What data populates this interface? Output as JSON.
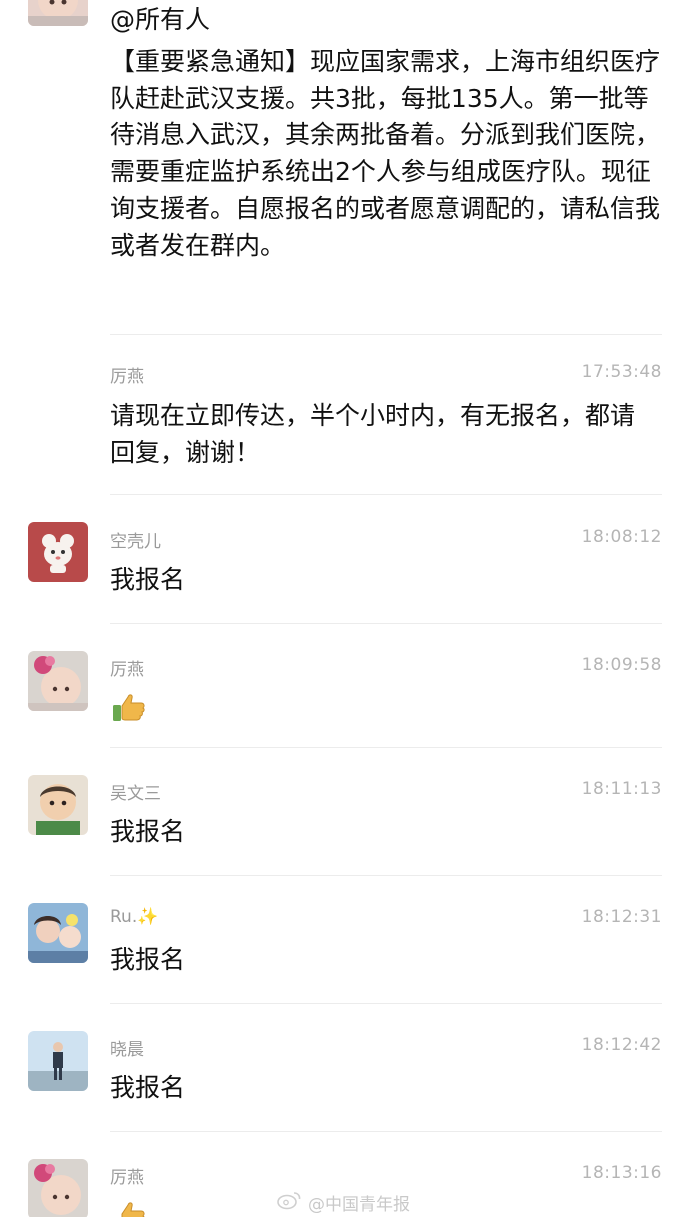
{
  "messages": [
    {
      "mention": "@所有人",
      "body": "【重要紧急通知】现应国家需求，上海市组织医疗队赶赴武汉支援。共3批，每批135人。第一批等待消息入武汉，其余两批备着。分派到我们医院，需要重症监护系统出2个人参与组成医疗队。现征询支援者。自愿报名的或者愿意调配的，请私信我或者发在群内。"
    },
    {
      "sender": "厉燕",
      "time": "17:53:48",
      "body": "请现在立即传达，半个小时内，有无报名，都请回复，谢谢！"
    },
    {
      "sender": "空壳儿",
      "time": "18:08:12",
      "body": "我报名"
    },
    {
      "sender": "厉燕",
      "time": "18:09:58",
      "emoji": "thumbs-up"
    },
    {
      "sender": "吴文三",
      "time": "18:11:13",
      "body": "我报名"
    },
    {
      "sender": "Ru.✨",
      "time": "18:12:31",
      "body": "我报名"
    },
    {
      "sender": "晓晨",
      "time": "18:12:42",
      "body": "我报名"
    },
    {
      "sender": "厉燕",
      "time": "18:13:16",
      "emoji": "thumbs-up"
    }
  ],
  "watermark": "@中国青年报"
}
